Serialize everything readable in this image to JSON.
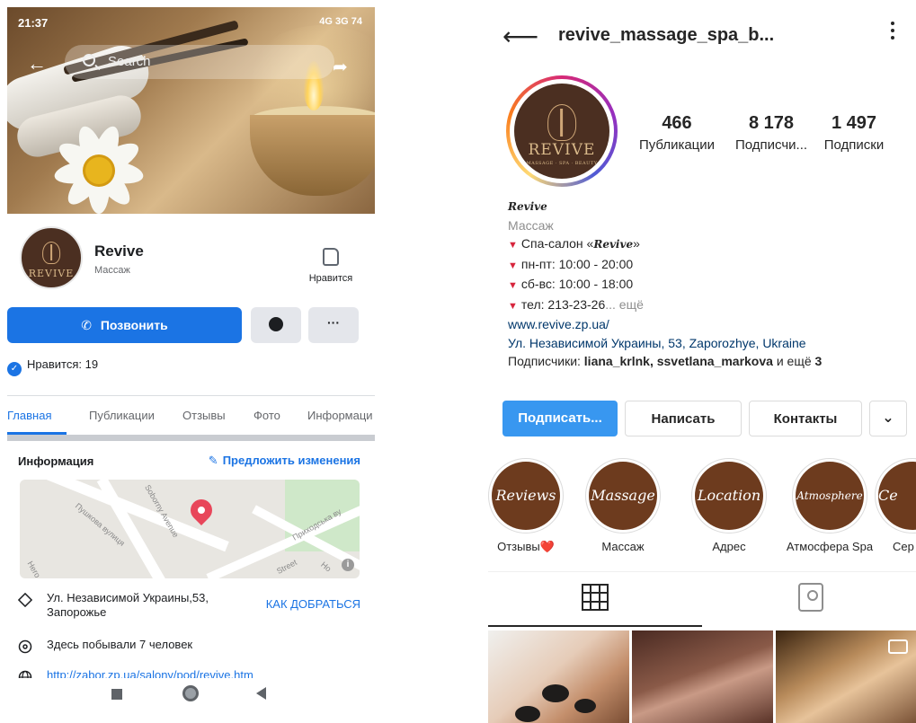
{
  "facebook": {
    "status_bar": {
      "time": "21:37",
      "icons_text": "4G 3G 74"
    },
    "search_placeholder": "Search",
    "page": {
      "name": "Revive",
      "category": "Массаж",
      "like_label": "Нравится",
      "likes_count_text": "Нравится: 19"
    },
    "logo_text": "REVIVE",
    "actions": {
      "call_label": "Позвонить",
      "more_label": "···"
    },
    "tabs": [
      {
        "label": "Главная",
        "active": true
      },
      {
        "label": "Публикации",
        "active": false
      },
      {
        "label": "Отзывы",
        "active": false
      },
      {
        "label": "Фото",
        "active": false
      },
      {
        "label": "Информаци",
        "active": false
      }
    ],
    "info": {
      "heading": "Информация",
      "suggest_label": "Предложить изменения",
      "map_labels": [
        "Soborny Avenue",
        "Пушкова вулиця",
        "Приходська ву",
        "Street",
        "Hero",
        "Ho"
      ],
      "address_line1": "Ул. Независимой Украины,53,",
      "address_line2": "Запорожье",
      "directions_label": "КАК ДОБРАТЬСЯ",
      "visited_text": "Здесь побывали 7 человек",
      "website": "http://zabor.zp.ua/salony/pod/revive.htm"
    },
    "colors": {
      "accent": "#1b74e4",
      "text": "#1c1e21",
      "muted": "#65676b"
    }
  },
  "instagram": {
    "username": "revive_massage_spa_b...",
    "logo_text": "REVIVE",
    "logo_subtext": "MASSAGE · SPA · BEAUTY",
    "stats": [
      {
        "value": "466",
        "label": "Публикации"
      },
      {
        "value": "8 178",
        "label": "Подписчи..."
      },
      {
        "value": "1 497",
        "label": "Подписки"
      }
    ],
    "bio": {
      "name": "Revive",
      "category": "Массаж",
      "line1_prefix": "Спа-салон «",
      "line1_brand": "Revive",
      "line1_suffix": "»",
      "hours_weekdays": "пн-пт: 10:00 - 20:00",
      "hours_weekend": "сб-вс: 10:00 - 18:00",
      "phone": "тел: 213-23-26",
      "more": "... ещё",
      "website": "www.revive.zp.ua/",
      "address": "Ул. Независимой Украины, 53, Zaporozhye, Ukraine",
      "followed_by_prefix": "Подписчики: ",
      "followed_by_names": "liana_krlnk, ssvetlana_markova",
      "followed_by_suffix": " и ещё ",
      "followed_by_count": "3"
    },
    "buttons": {
      "follow": "Подписать...",
      "message": "Написать",
      "contacts": "Контакты",
      "dropdown": "⌄"
    },
    "highlights": [
      {
        "title": "Reviews",
        "caption": "Отзывы❤️"
      },
      {
        "title": "Massage",
        "caption": "Массаж"
      },
      {
        "title": "Location",
        "caption": "Адрес"
      },
      {
        "title": "Atmosphere",
        "caption": "Атмосфера Spa"
      },
      {
        "title": "Ce",
        "caption": "Сер"
      }
    ],
    "colors": {
      "follow_blue": "#3897f0",
      "link": "#00376b",
      "highlight_brown": "#6d3b1e"
    }
  }
}
